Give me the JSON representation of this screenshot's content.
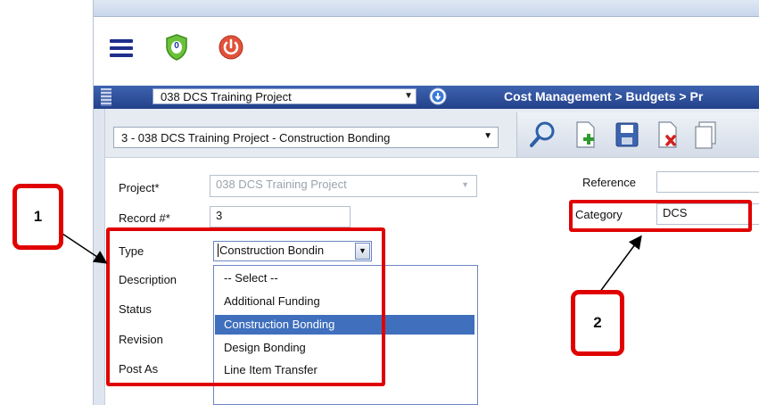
{
  "header": {
    "shield_count": "0",
    "project_selector_value": "038 DCS Training Project",
    "breadcrumb": "Cost Management > Budgets > Pr"
  },
  "record_selector_value": "3 - 038 DCS Training Project - Construction Bonding",
  "form": {
    "project_label": "Project*",
    "project_value": "038 DCS Training Project",
    "record_label": "Record #*",
    "record_value": "3",
    "type_label": "Type",
    "type_value": "Construction Bondin",
    "description_label": "Description",
    "status_label": "Status",
    "revision_label": "Revision",
    "post_as_label": "Post As",
    "reference_label": "Reference",
    "reference_value": "",
    "category_label": "Category",
    "category_value": "DCS"
  },
  "type_options": [
    "-- Select --",
    "Additional Funding",
    "Construction Bonding",
    "Design Bonding",
    "Line Item Transfer"
  ],
  "type_selected": "Construction Bonding",
  "callouts": {
    "one": "1",
    "two": "2"
  },
  "icons": [
    "hamburger-menu-icon",
    "shield-icon",
    "power-icon",
    "info-icon",
    "search-icon",
    "add-document-icon",
    "save-icon",
    "delete-document-icon",
    "copy-document-icon"
  ],
  "colors": {
    "highlight": "#e00000",
    "header_blue": "#2d4c99",
    "selected_option": "#3f6fbd"
  }
}
